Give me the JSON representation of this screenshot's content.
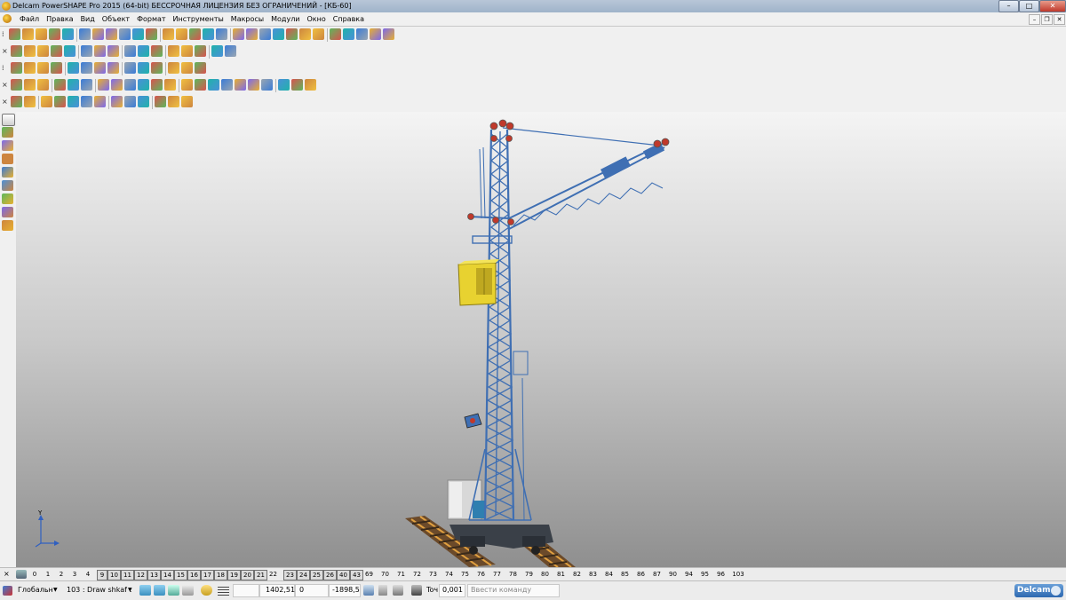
{
  "window": {
    "title": "Delcam PowerSHAPE Pro 2015 (64-bit) БЕССРОЧНАЯ ЛИЦЕНЗИЯ БЕЗ ОГРАНИЧЕНИЙ - [КБ-60]",
    "minimize": "–",
    "maximize": "□",
    "close": "✕",
    "doc_minimize": "–",
    "doc_restore": "❐",
    "doc_close": "✕"
  },
  "menu": [
    "Файл",
    "Правка",
    "Вид",
    "Объект",
    "Формат",
    "Инструменты",
    "Макросы",
    "Модули",
    "Окно",
    "Справка"
  ],
  "viewport": {
    "axis_label": "Y"
  },
  "levels": [
    "0",
    "1",
    "2",
    "3",
    "4",
    "9",
    "10",
    "11",
    "12",
    "13",
    "14",
    "15",
    "16",
    "17",
    "18",
    "19",
    "20",
    "21",
    "22",
    "23",
    "24",
    "25",
    "26",
    "40",
    "43",
    "69",
    "70",
    "71",
    "72",
    "73",
    "74",
    "75",
    "76",
    "77",
    "78",
    "79",
    "80",
    "81",
    "82",
    "83",
    "84",
    "85",
    "86",
    "87",
    "90",
    "94",
    "95",
    "96",
    "103"
  ],
  "levels_boxed": [
    "9",
    "10",
    "11",
    "12",
    "13",
    "14",
    "15",
    "16",
    "17",
    "18",
    "19",
    "20",
    "21",
    "23",
    "24",
    "25",
    "26",
    "40",
    "43"
  ],
  "status": {
    "workplane": "Глобальн",
    "workplane_arrow": "▼",
    "macro": "103 : Draw shkaf ι",
    "macro_arrow": "▼",
    "coord_x": "1402,51",
    "coord_y": "0",
    "coord_z": "-1898,5",
    "tolerance_label": "Toч",
    "tolerance_value": "0,001",
    "command_placeholder": "Ввести команду",
    "brand": "Delcam"
  }
}
